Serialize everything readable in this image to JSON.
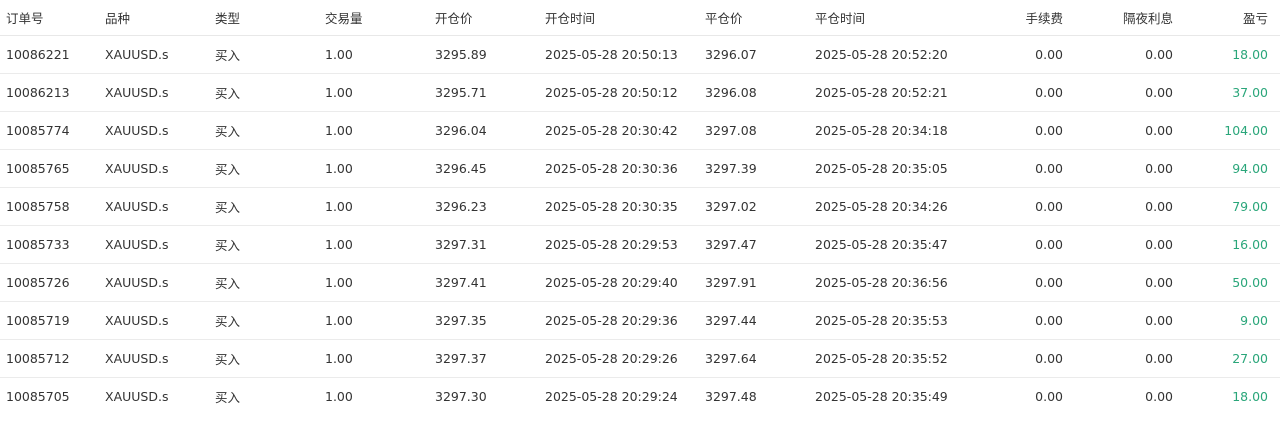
{
  "table": {
    "columns": [
      "订单号",
      "品种",
      "类型",
      "交易量",
      "开仓价",
      "开仓时间",
      "平仓价",
      "平仓时间",
      "手续费",
      "隔夜利息",
      "盈亏"
    ],
    "rows": [
      [
        "10086221",
        "XAUUSD.s",
        "买入",
        "1.00",
        "3295.89",
        "2025-05-28 20:50:13",
        "3296.07",
        "2025-05-28 20:52:20",
        "0.00",
        "0.00",
        "18.00"
      ],
      [
        "10086213",
        "XAUUSD.s",
        "买入",
        "1.00",
        "3295.71",
        "2025-05-28 20:50:12",
        "3296.08",
        "2025-05-28 20:52:21",
        "0.00",
        "0.00",
        "37.00"
      ],
      [
        "10085774",
        "XAUUSD.s",
        "买入",
        "1.00",
        "3296.04",
        "2025-05-28 20:30:42",
        "3297.08",
        "2025-05-28 20:34:18",
        "0.00",
        "0.00",
        "104.00"
      ],
      [
        "10085765",
        "XAUUSD.s",
        "买入",
        "1.00",
        "3296.45",
        "2025-05-28 20:30:36",
        "3297.39",
        "2025-05-28 20:35:05",
        "0.00",
        "0.00",
        "94.00"
      ],
      [
        "10085758",
        "XAUUSD.s",
        "买入",
        "1.00",
        "3296.23",
        "2025-05-28 20:30:35",
        "3297.02",
        "2025-05-28 20:34:26",
        "0.00",
        "0.00",
        "79.00"
      ],
      [
        "10085733",
        "XAUUSD.s",
        "买入",
        "1.00",
        "3297.31",
        "2025-05-28 20:29:53",
        "3297.47",
        "2025-05-28 20:35:47",
        "0.00",
        "0.00",
        "16.00"
      ],
      [
        "10085726",
        "XAUUSD.s",
        "买入",
        "1.00",
        "3297.41",
        "2025-05-28 20:29:40",
        "3297.91",
        "2025-05-28 20:36:56",
        "0.00",
        "0.00",
        "50.00"
      ],
      [
        "10085719",
        "XAUUSD.s",
        "买入",
        "1.00",
        "3297.35",
        "2025-05-28 20:29:36",
        "3297.44",
        "2025-05-28 20:35:53",
        "0.00",
        "0.00",
        "9.00"
      ],
      [
        "10085712",
        "XAUUSD.s",
        "买入",
        "1.00",
        "3297.37",
        "2025-05-28 20:29:26",
        "3297.64",
        "2025-05-28 20:35:52",
        "0.00",
        "0.00",
        "27.00"
      ],
      [
        "10085705",
        "XAUUSD.s",
        "买入",
        "1.00",
        "3297.30",
        "2025-05-28 20:29:24",
        "3297.48",
        "2025-05-28 20:35:49",
        "0.00",
        "0.00",
        "18.00"
      ]
    ]
  },
  "colors": {
    "profit": "#2aa67a",
    "text": "#333333",
    "divider": "#ebebeb"
  }
}
